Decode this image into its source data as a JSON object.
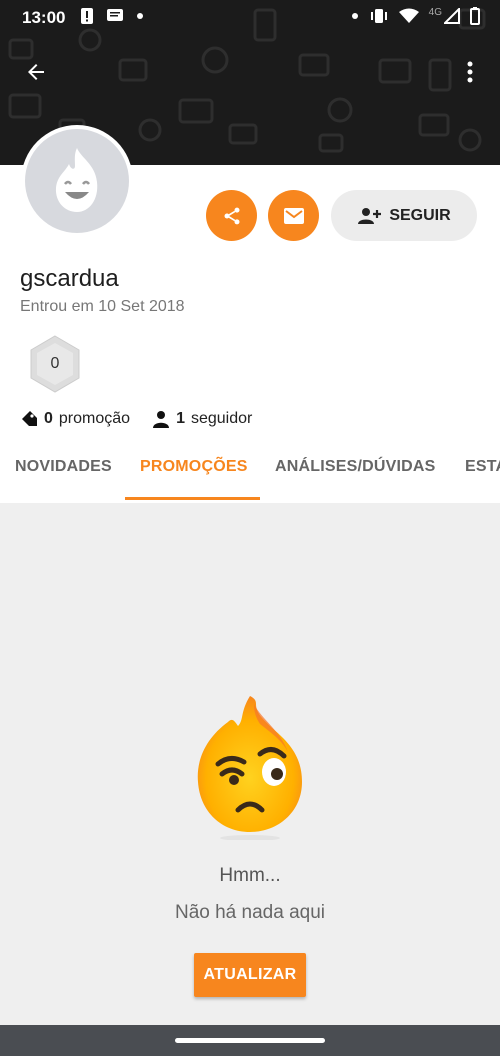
{
  "status_bar": {
    "time": "13:00",
    "network": "4G"
  },
  "header": {
    "back_icon": "arrow-back-icon",
    "more_icon": "more-vert-icon"
  },
  "profile": {
    "username": "gscardua",
    "joined": "Entrou em 10 Set 2018",
    "level": "0",
    "follow_label": "SEGUIR",
    "promotions_count": "0",
    "promotions_label": "promoção",
    "followers_count": "1",
    "followers_label": "seguidor"
  },
  "tabs": [
    {
      "label": "NOVIDADES"
    },
    {
      "label": "PROMOÇÕES"
    },
    {
      "label": "ANÁLISES/DÚVIDAS"
    },
    {
      "label": "ESTATÍSTICAS"
    }
  ],
  "empty_state": {
    "title": "Hmm...",
    "message": "Não há nada aqui",
    "refresh_label": "ATUALIZAR"
  },
  "colors": {
    "accent": "#f7861e",
    "header_bg": "#1b1b1b",
    "page_bg": "#efefef"
  }
}
